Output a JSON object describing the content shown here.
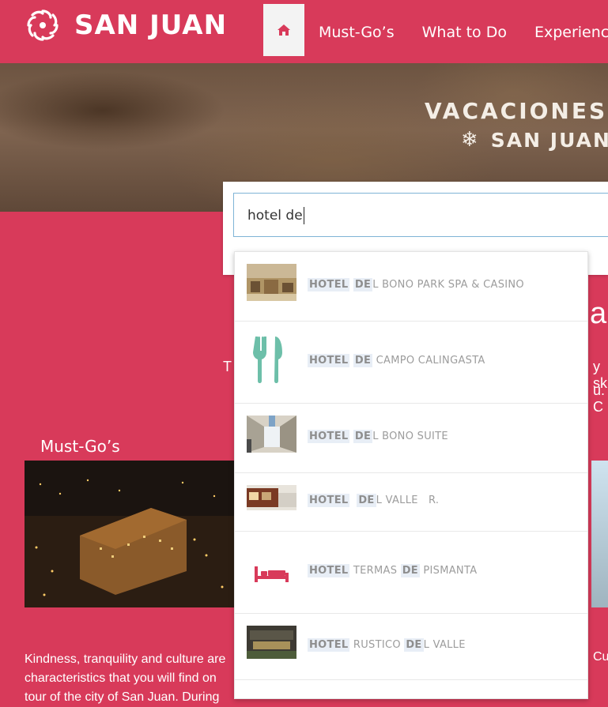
{
  "header": {
    "logo_text": "SAN JUAN",
    "nav": [
      "Must-Go’s",
      "What to Do",
      "Experience"
    ]
  },
  "hero": {
    "title": "VACACIONES D",
    "subtitle": "SAN JUAN"
  },
  "search": {
    "value": "hotel de"
  },
  "suggestions": [
    {
      "parts": [
        {
          "t": "HOTEL",
          "hl": true
        },
        {
          "t": " ",
          "hl": false
        },
        {
          "t": "DE",
          "hl": true
        },
        {
          "t": "L BONO PARK SPA & CASINO",
          "hl": false
        }
      ],
      "thumb": "photo"
    },
    {
      "parts": [
        {
          "t": "HOTEL",
          "hl": true
        },
        {
          "t": " ",
          "hl": false
        },
        {
          "t": "DE",
          "hl": true
        },
        {
          "t": " CAMPO CALINGASTA",
          "hl": false
        }
      ],
      "thumb": "fork-knife-icon"
    },
    {
      "parts": [
        {
          "t": "HOTEL",
          "hl": true
        },
        {
          "t": " ",
          "hl": false
        },
        {
          "t": "DE",
          "hl": true
        },
        {
          "t": "L BONO SUITE",
          "hl": false
        }
      ],
      "thumb": "photo"
    },
    {
      "parts": [
        {
          "t": "HOTEL",
          "hl": true
        },
        {
          "t": "  ",
          "hl": false
        },
        {
          "t": "DE",
          "hl": true
        },
        {
          "t": "L VALLE   R.",
          "hl": false
        }
      ],
      "thumb": "photo"
    },
    {
      "parts": [
        {
          "t": "HOTEL",
          "hl": true
        },
        {
          "t": " TERMAS ",
          "hl": false
        },
        {
          "t": "DE",
          "hl": true
        },
        {
          "t": " PISMANTA",
          "hl": false
        }
      ],
      "thumb": "bed-icon"
    },
    {
      "parts": [
        {
          "t": "HOTEL",
          "hl": true
        },
        {
          "t": " RUSTICO ",
          "hl": false
        },
        {
          "t": "DE",
          "hl": true
        },
        {
          "t": "L VALLE",
          "hl": false
        }
      ],
      "thumb": "photo"
    }
  ],
  "background": {
    "heading_fragment": "a",
    "line_left_fragment": "T",
    "line_right_1": "y sk",
    "line_right_2": "u. C",
    "section_title": "Must-Go’s",
    "paragraph": "Kindness, tranquility and culture are characteristics that you will find on tour of the city of San Juan. During",
    "paragraph_right": "Cu"
  },
  "colors": {
    "brand": "#d83a5a",
    "highlight": "#e8eef6",
    "input_border": "#7fb4d6",
    "icon_teal": "#6dbfa9",
    "icon_pink": "#d83a5a"
  }
}
